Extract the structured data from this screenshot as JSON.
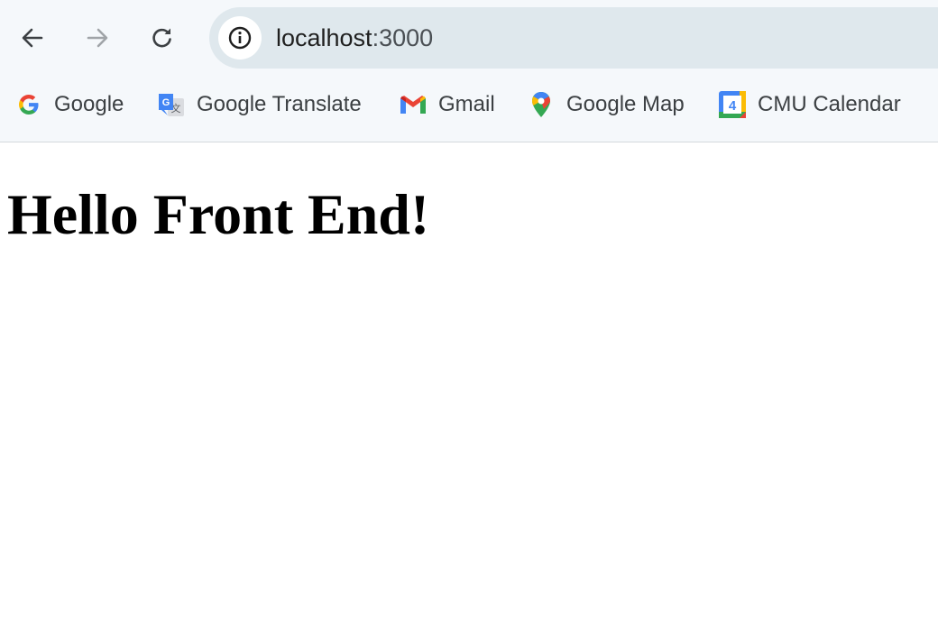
{
  "browser": {
    "nav": {
      "back_icon": "arrow-left-icon",
      "forward_icon": "arrow-right-icon",
      "reload_icon": "reload-icon"
    },
    "address_bar": {
      "site_info_icon": "info-icon",
      "host": "localhost",
      "port": ":3000"
    },
    "bookmarks": [
      {
        "label": "Google",
        "icon": "google-icon"
      },
      {
        "label": "Google Translate",
        "icon": "google-translate-icon"
      },
      {
        "label": "Gmail",
        "icon": "gmail-icon"
      },
      {
        "label": "Google Map",
        "icon": "google-maps-icon"
      },
      {
        "label": "CMU Calendar",
        "icon": "calendar-icon",
        "icon_text": "4"
      }
    ],
    "colors": {
      "toolbar_bg": "#f5f8fb",
      "omnibox_bg": "#dfe8ed"
    }
  },
  "page": {
    "heading": "Hello Front End!"
  }
}
